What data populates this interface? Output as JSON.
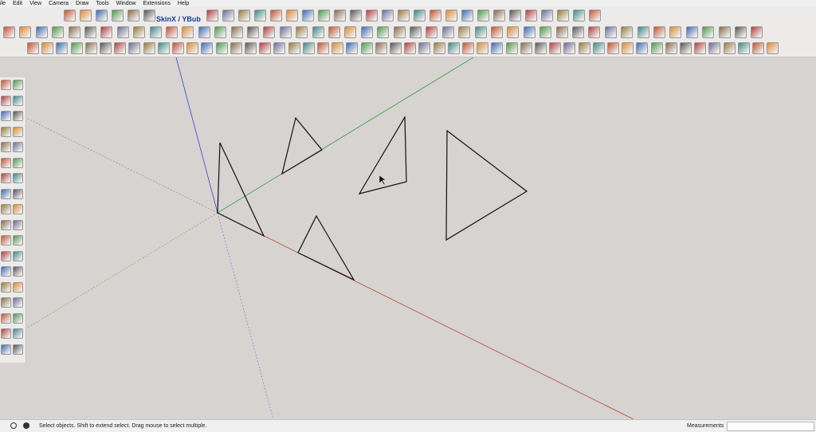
{
  "menu": [
    "ile",
    "Edit",
    "View",
    "Camera",
    "Draw",
    "Tools",
    "Window",
    "Extensions",
    "Help"
  ],
  "brand_text": "SkinX / YBub",
  "status": {
    "hint": "Select objects. Shift to extend select. Drag mouse to select multiple.",
    "measurements_label": "Measurements",
    "measurements_value": ""
  },
  "colors": {
    "red_axis": "#b04a3a",
    "green_axis": "#3c9a3c",
    "blue_axis": "#3a45c8"
  },
  "icons": {
    "toolbar1": [
      "save-icon",
      "undo-icon",
      "stop-icon",
      "back-icon",
      "pointer-icon",
      "walk-icon",
      "camera-icon",
      "record-icon",
      "arc-icon",
      "pan-icon",
      "zoom-icon",
      "orbit-icon",
      "curve-icon",
      "line-icon",
      "push-icon",
      "follow-icon",
      "scale-icon",
      "paint-icon",
      "components-icon",
      "materials-icon",
      "styles-icon",
      "layers-icon",
      "outliner-icon",
      "scenes-icon",
      "shadows-icon",
      "fog-icon",
      "match-photo-icon",
      "sandbox-icon",
      "warehouse-icon",
      "extension-icon",
      "geo-icon"
    ],
    "toolbar2": [
      "select-icon",
      "eraser-icon",
      "pencil-icon",
      "arc-tool-icon",
      "rectangle-icon",
      "push-pull-icon",
      "move-icon",
      "rotate-icon",
      "scale-tool-icon",
      "offset-icon",
      "tape-icon",
      "text-icon",
      "axes-icon",
      "protractor-icon",
      "dimension-icon",
      "section-icon",
      "orbit-tool-icon",
      "pan-tool-icon",
      "zoom-tool-icon",
      "zoom-window-icon",
      "zoom-extents-icon",
      "previous-icon",
      "next-icon",
      "position-camera-icon",
      "look-around-icon",
      "walk-tool-icon",
      "xray-icon",
      "back-edges-icon",
      "wireframe-icon",
      "hidden-line-icon",
      "shaded-icon",
      "textured-icon",
      "monochrome-icon",
      "iso-view-icon",
      "top-view-icon",
      "front-view-icon",
      "right-view-icon",
      "back-view-icon",
      "left-view-icon",
      "bottom-view-icon",
      "intersect-icon",
      "union-icon",
      "subtract-icon",
      "trim-icon",
      "split-icon",
      "outer-shell-icon",
      "solid-icon"
    ],
    "toolbar3": [
      "cube-icon",
      "dice-icon",
      "hidden-cube-icon",
      "component-icon",
      "explode-icon",
      "group-icon",
      "ungroup-icon",
      "lock-icon",
      "unlock-icon",
      "hide-icon",
      "unhide-icon",
      "curve-a-icon",
      "curve-b-icon",
      "curve-c-icon",
      "curve-d-icon",
      "curve-e-icon",
      "curve-f-icon",
      "curve-g-icon",
      "curve-h-icon",
      "curve-i-icon",
      "curve-j-icon",
      "curve-k-icon",
      "curve-l-icon",
      "curve-m-icon",
      "curve-n-icon",
      "curve-o-icon",
      "curve-p-icon",
      "curve-q-icon",
      "curve-r-icon",
      "curve-s-icon",
      "curve-t-icon",
      "curve-u-icon",
      "curve-v-icon",
      "curve-w-icon",
      "curve-x-icon",
      "curve-y-icon",
      "curve-z-icon",
      "shape-a-icon",
      "shape-b-icon",
      "shape-c-icon",
      "shape-d-icon",
      "shape-e-icon",
      "shape-f-icon",
      "shape-g-icon",
      "shape-h-icon",
      "shape-i-icon",
      "shape-j-icon",
      "shape-k-icon",
      "shape-l-icon",
      "shape-m-icon",
      "shape-n-icon",
      "shape-o-icon"
    ],
    "left": [
      "select-tool-icon",
      "component-tool-icon",
      "paint-tool-icon",
      "eraser-tool-icon",
      "line-tool-icon",
      "freehand-tool-icon",
      "rectangle-tool-icon",
      "rotated-rect-icon",
      "circle-tool-icon",
      "polygon-tool-icon",
      "arc-tool-a-icon",
      "arc-tool-b-icon",
      "arc-tool-c-icon",
      "pie-tool-icon",
      "move-tool-icon",
      "push-pull-tool-icon",
      "rotate-tool-icon",
      "follow-me-tool-icon",
      "scale-tool-b-icon",
      "offset-tool-icon",
      "tape-tool-icon",
      "text-tool-b-icon",
      "protractor-tool-icon",
      "axes-tool-icon",
      "dimension-tool-icon",
      "text-3d-icon",
      "orbit-tool-b-icon",
      "pan-tool-b-icon",
      "zoom-tool-b-icon",
      "zoom-window-b-icon",
      "zoom-extents-b-icon",
      "zoom-previous-icon",
      "position-tool-icon",
      "look-tool-icon",
      "walk-tool-b-icon",
      "section-tool-icon"
    ]
  }
}
